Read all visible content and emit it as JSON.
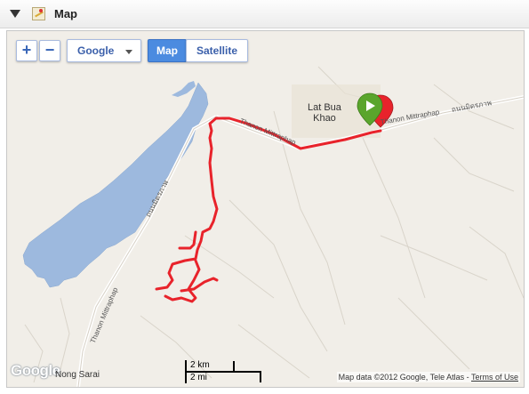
{
  "panel": {
    "title": "Map"
  },
  "controls": {
    "zoom_in": "+",
    "zoom_out": "−",
    "provider": "Google",
    "map_label": "Map",
    "satellite_label": "Satellite"
  },
  "places": {
    "lat_bua_khao_line1": "Lat Bua",
    "lat_bua_khao_line2": "Khao",
    "nong_sarai": "Nong Sarai"
  },
  "roads": {
    "mittraphap_top": "Thanon Mittraphap",
    "mittraphap_east": "Thanon Mittraphap",
    "mittraphap_thai": "ถนนมิตรภาพ",
    "mittraphap_west": "Thanon Mittraphap",
    "mittraphap_thai_west": "ถนนมิตรภาพ"
  },
  "scale": {
    "km": "2 km",
    "mi": "2 mi"
  },
  "attribution": {
    "text": "Map data ©2012 Google, Tele Atlas - ",
    "terms": "Terms of Use"
  },
  "logo": "Google",
  "colors": {
    "route": "#e8232b",
    "water": "#9db9de",
    "accent": "#4b8be0",
    "start_marker": "#5aa52c"
  }
}
